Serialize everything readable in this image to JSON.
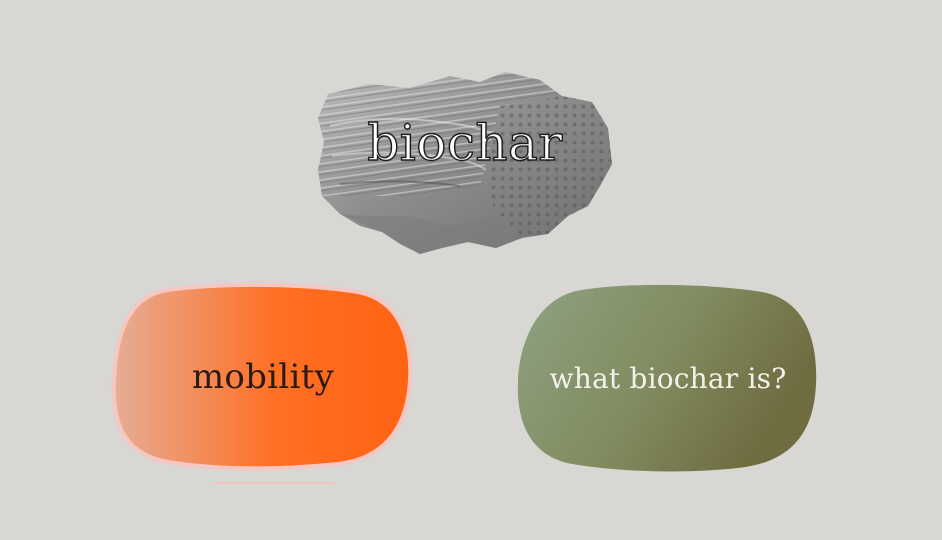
{
  "main": {
    "title": "biochar",
    "title_image": "biochar-rock-image",
    "buttons": [
      {
        "label": "mobility",
        "color_from": "#e6ad95",
        "color_to": "#ff6312",
        "border": "#f6c6c3"
      },
      {
        "label": "what biochar is?",
        "color_from": "#8ea282",
        "color_to": "#6f6c40"
      }
    ]
  },
  "colors": {
    "background": "#d9d7d4"
  }
}
